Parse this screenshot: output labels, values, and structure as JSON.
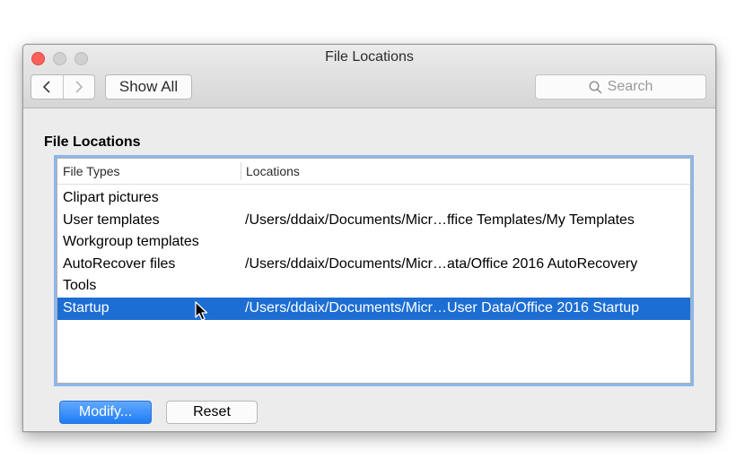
{
  "window": {
    "title": "File Locations"
  },
  "toolbar": {
    "show_all_label": "Show All",
    "search_placeholder": "Search"
  },
  "section": {
    "title": "File Locations"
  },
  "table": {
    "columns": [
      "File Types",
      "Locations"
    ],
    "rows": [
      {
        "type": "Clipart pictures",
        "location": ""
      },
      {
        "type": "User templates",
        "location": "/Users/ddaix/Documents/Micr…ffice Templates/My Templates"
      },
      {
        "type": "Workgroup templates",
        "location": ""
      },
      {
        "type": "AutoRecover files",
        "location": "/Users/ddaix/Documents/Micr…ata/Office 2016 AutoRecovery"
      },
      {
        "type": "Tools",
        "location": ""
      },
      {
        "type": "Startup",
        "location": "/Users/ddaix/Documents/Micr…User Data/Office 2016 Startup"
      }
    ],
    "selected_index": 5
  },
  "buttons": {
    "modify_label": "Modify...",
    "reset_label": "Reset"
  },
  "icons": {
    "back": "chevron-left-icon",
    "forward": "chevron-right-icon",
    "search": "magnifier-icon",
    "cursor": "arrow-cursor-icon"
  },
  "colors": {
    "selection": "#1d6ed4",
    "primary_button": "#1e7cf5",
    "focus_ring": "#8ab7ea",
    "close": "#fc605b"
  }
}
